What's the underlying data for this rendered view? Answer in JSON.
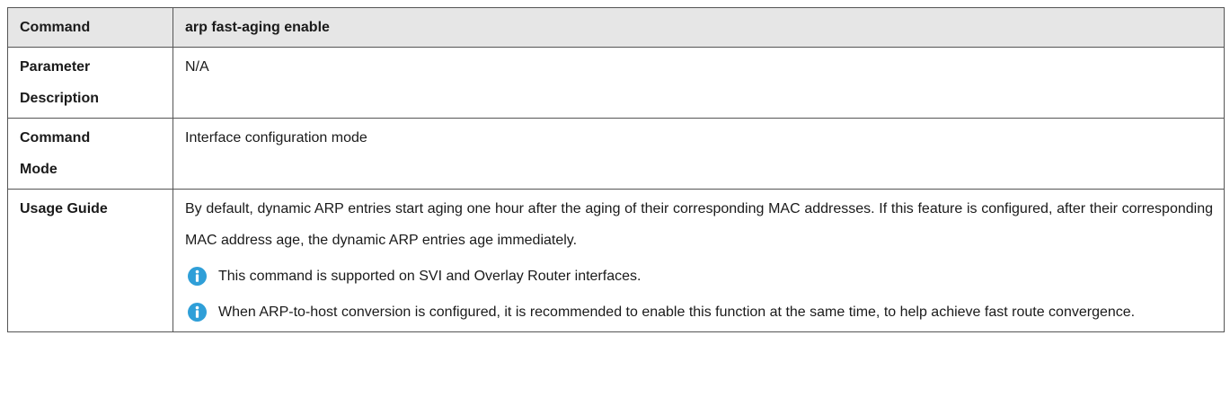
{
  "rows": {
    "command": {
      "label": "Command",
      "value": "arp fast-aging enable"
    },
    "parameter_description": {
      "label_line1": "Parameter",
      "label_line2": "Description",
      "value": "N/A"
    },
    "command_mode": {
      "label_line1": "Command",
      "label_line2": "Mode",
      "value": "Interface configuration mode"
    },
    "usage_guide": {
      "label": "Usage Guide",
      "paragraph": "By default, dynamic ARP entries start aging one hour after the aging of their corresponding MAC addresses. If this feature is configured, after their corresponding MAC address age, the dynamic ARP entries age immediately.",
      "notes": [
        {
          "icon": "info-icon",
          "text": "This command is supported on SVI and Overlay Router interfaces."
        },
        {
          "icon": "info-icon",
          "text": "When ARP-to-host conversion is configured, it is recommended to enable this function at the same time, to help achieve fast route convergence."
        }
      ]
    }
  },
  "colors": {
    "header_background": "#e6e6e6",
    "border": "#555555",
    "info_icon": "#2f9fd8"
  }
}
